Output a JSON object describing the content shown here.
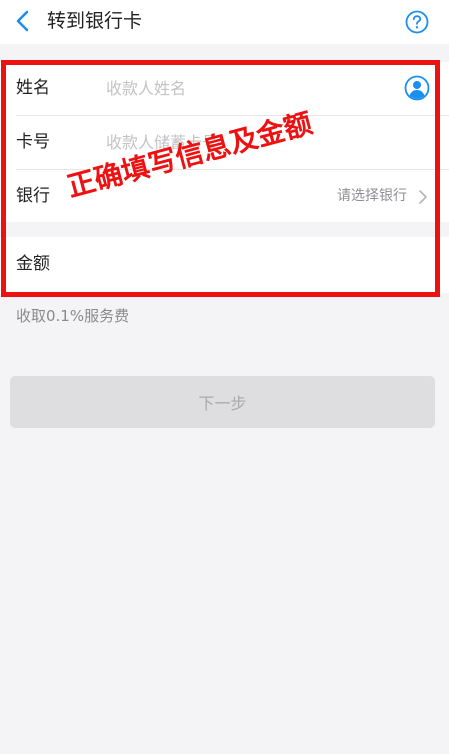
{
  "header": {
    "title": "转到银行卡",
    "back_icon": "chevron-left-icon",
    "help_icon": "question-circle-icon"
  },
  "form": {
    "name": {
      "label": "姓名",
      "placeholder": "收款人姓名",
      "value": "",
      "contact_icon": "contact-book-icon"
    },
    "card": {
      "label": "卡号",
      "placeholder": "收款人储蓄卡号",
      "value": ""
    },
    "bank": {
      "label": "银行",
      "placeholder": "请选择银行",
      "chevron_icon": "chevron-right-icon"
    },
    "amount": {
      "label": "金额",
      "value": ""
    }
  },
  "fee_note": "收取0.1%服务费",
  "next_button": {
    "label": "下一步",
    "enabled": false
  },
  "annotation": {
    "text": "正确填写信息及金额",
    "color": "#ee1111"
  },
  "colors": {
    "accent": "#1a8ff0",
    "background": "#f4f4f6",
    "placeholder": "#c3c3c6",
    "button_disabled": "#dedee0"
  }
}
